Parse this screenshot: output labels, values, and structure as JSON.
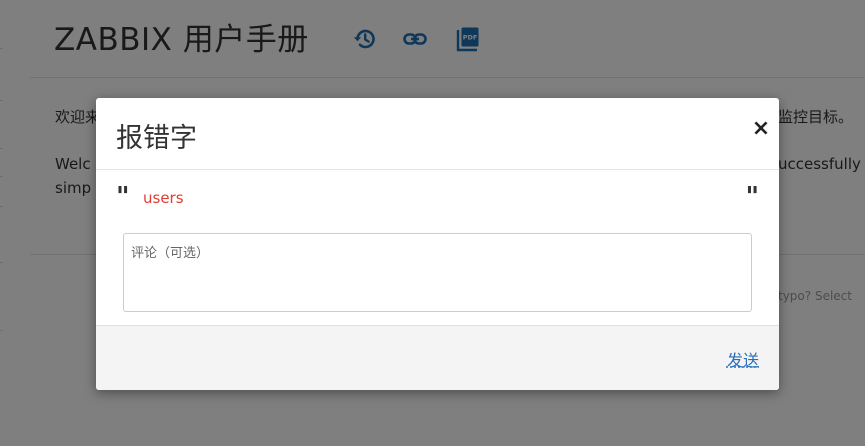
{
  "page": {
    "title": "ZABBIX 用户手册",
    "header_icons": [
      "history-icon",
      "link-icon",
      "pdf-icon"
    ],
    "pdf_label": "PDF",
    "intro_cn_left": "欢迎来",
    "intro_cn_right": "监控目标。",
    "intro_en_left": "Welc",
    "intro_en_right": "uccessfully",
    "intro_en_line2": "simp",
    "typo_hint": "typo? Select"
  },
  "modal": {
    "title": "报错字",
    "close_label": "×",
    "quote_open": "\"",
    "quote_close": "\"",
    "selected_text": "users",
    "comment_placeholder": "评论（可选）",
    "comment_value": "",
    "send_label": "发送"
  },
  "colors": {
    "accent": "#2a6ebb",
    "selected_text": "#e03c31",
    "icon_blue": "#1f6fb2"
  }
}
